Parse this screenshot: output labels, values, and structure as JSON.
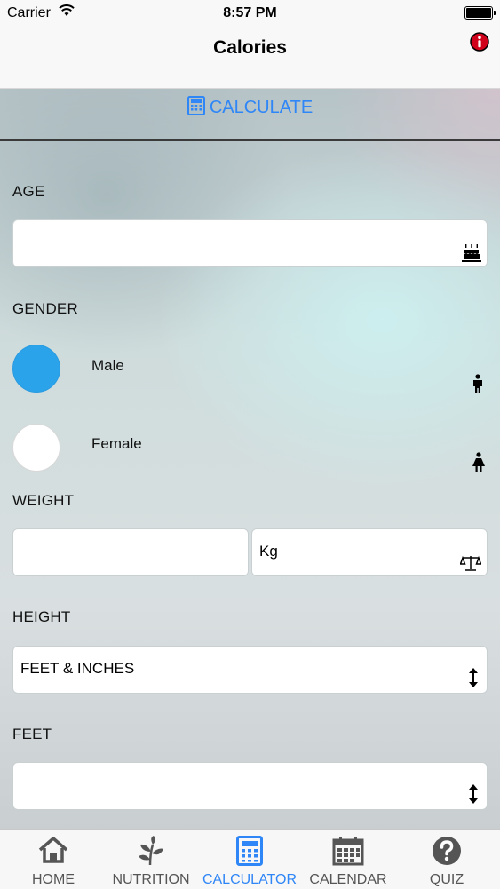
{
  "status_bar": {
    "carrier": "Carrier",
    "time": "8:57 PM"
  },
  "nav": {
    "title": "Calories"
  },
  "calculate": {
    "label": "CALCULATE"
  },
  "form": {
    "age": {
      "label": "AGE",
      "value": ""
    },
    "gender": {
      "label": "GENDER",
      "options": [
        {
          "label": "Male",
          "selected": true
        },
        {
          "label": "Female",
          "selected": false
        }
      ]
    },
    "weight": {
      "label": "WEIGHT",
      "value": "",
      "unit": "Kg"
    },
    "height": {
      "label": "HEIGHT",
      "unit_system": "FEET & INCHES"
    },
    "feet": {
      "label": "FEET",
      "value": ""
    }
  },
  "tabs": [
    {
      "label": "HOME",
      "icon": "home-icon",
      "active": false
    },
    {
      "label": "NUTRITION",
      "icon": "leaf-icon",
      "active": false
    },
    {
      "label": "CALCULATOR",
      "icon": "calculator-icon",
      "active": true
    },
    {
      "label": "CALENDAR",
      "icon": "calendar-icon",
      "active": false
    },
    {
      "label": "QUIZ",
      "icon": "question-icon",
      "active": false
    }
  ],
  "colors": {
    "accent": "#2f86f6",
    "radio_selected": "#2ba3ea",
    "info_icon": "#d0021b"
  }
}
